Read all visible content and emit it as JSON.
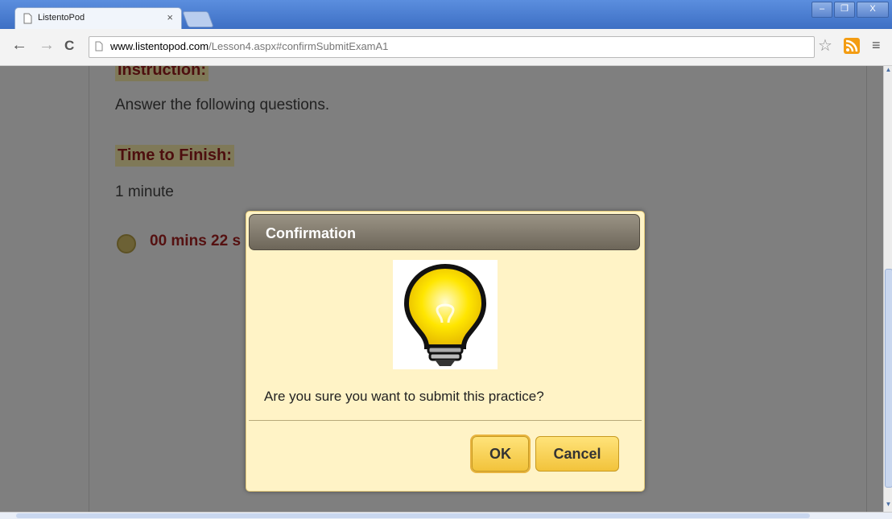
{
  "browser": {
    "tab_title": "ListentoPod",
    "tab_close": "×",
    "url_domain": "www.listentopod.com",
    "url_path": "/Lesson4.aspx#confirmSubmitExamA1",
    "window_buttons": {
      "minimize": "–",
      "restore": "❐",
      "close": "X"
    },
    "nav": {
      "back": "←",
      "forward": "→",
      "reload": "C"
    },
    "star": "☆",
    "menu": "≡"
  },
  "page": {
    "instruction_heading": "Instruction:",
    "instruction_text": "Answer the following questions.",
    "time_heading": "Time to Finish:",
    "time_value": "1 minute",
    "timer": "00 mins 22 s"
  },
  "dialog": {
    "title": "Confirmation",
    "message": "Are you sure you want to submit this practice?",
    "ok_label": "OK",
    "cancel_label": "Cancel",
    "icon": "lightbulb-icon"
  },
  "colors": {
    "dialog_bg": "#fff3c6",
    "button_gold": "#f2c33b",
    "heading_red": "#9b1c1c"
  }
}
